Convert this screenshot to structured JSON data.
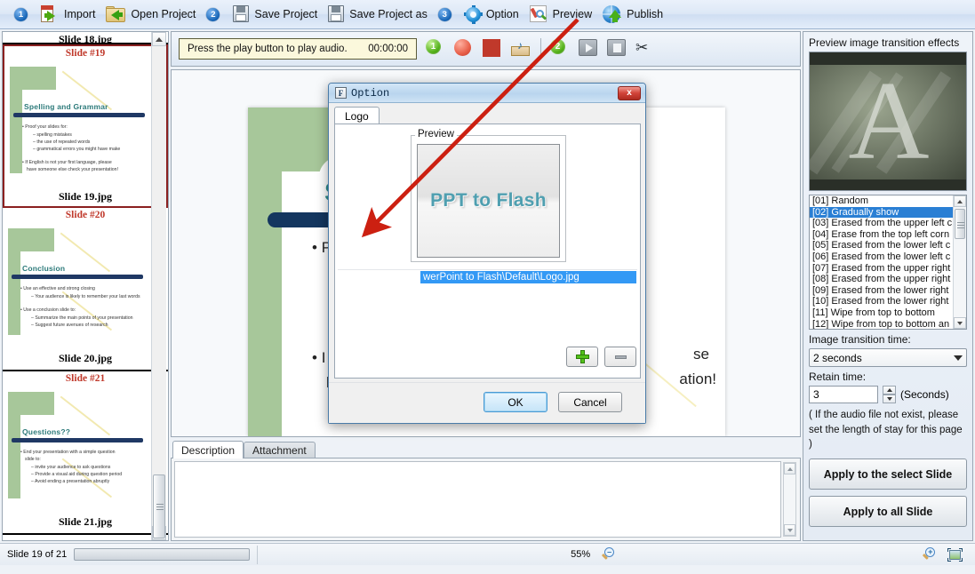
{
  "toolbar": {
    "steps": [
      {
        "badge": "1",
        "items": [
          {
            "label": "Import",
            "icon": "import-icon"
          },
          {
            "label": "Open Project",
            "icon": "open-folder-icon"
          }
        ]
      },
      {
        "badge": "2",
        "items": [
          {
            "label": "Save Project",
            "icon": "floppy-disk-icon"
          },
          {
            "label": "Save Project as",
            "icon": "floppy-disk-icon"
          }
        ]
      },
      {
        "badge": "3",
        "items": [
          {
            "label": "Option",
            "icon": "gear-icon"
          },
          {
            "label": "Preview",
            "icon": "magnifier-pencil-icon"
          },
          {
            "label": "Publish",
            "icon": "globe-upload-icon"
          }
        ]
      }
    ]
  },
  "slide_panel": {
    "thumbnails": [
      {
        "header": "",
        "footer": "Slide 18.jpg",
        "selected": false,
        "title": "",
        "bullets": []
      },
      {
        "header": "Slide #19",
        "footer": "Slide 19.jpg",
        "selected": true,
        "title": "Spelling and Grammar",
        "bullets": [
          "Proof your slides for:",
          "spelling mistakes",
          "the use of repeated words",
          "grammatical errors you might have make",
          "If English is not your first language, please",
          "have someone else check your presentation!"
        ]
      },
      {
        "header": "Slide #20",
        "footer": "Slide 20.jpg",
        "selected": false,
        "title": "Conclusion",
        "bullets": [
          "Use an effective and strong closing",
          "Your audience is likely to remember your last words",
          "Use a conclusion slide to:",
          "Summarize the main points of your presentation",
          "Suggest future avenues of research"
        ]
      },
      {
        "header": "Slide #21",
        "footer": "Slide 21.jpg",
        "selected": false,
        "title": "Questions??",
        "bullets": [
          "End your presentation with a simple question",
          "slide to:",
          "invite your audience to ask questions",
          "Provide a visual aid during question period",
          "Avoid ending a presentation abruptly"
        ]
      }
    ]
  },
  "audio_bar": {
    "message": "Press the play button to play audio.",
    "time": "00:00:00",
    "group1_badge": "1",
    "group2_badge": "2",
    "buttons": [
      {
        "name": "record-button",
        "icon": "record-circle-icon"
      },
      {
        "name": "stop-record-button",
        "icon": "stop-square-red-icon"
      },
      {
        "name": "import-audio-button",
        "icon": "audio-import-icon"
      },
      {
        "name": "play-button",
        "icon": "play-triangle-icon"
      },
      {
        "name": "stop-play-button",
        "icon": "stop-square-gray-icon"
      },
      {
        "name": "delete-audio-button",
        "icon": "scissors-icon"
      }
    ]
  },
  "slide_view": {
    "title": "Sp",
    "bullet1": "P",
    "bullet2_line1": "I",
    "bullet2_line2": "h",
    "right_text1": "se",
    "right_text2": "ation!"
  },
  "description": {
    "tabs": [
      {
        "label": "Description",
        "active": true
      },
      {
        "label": "Attachment",
        "active": false
      }
    ],
    "text": ""
  },
  "right_panel": {
    "preview_title": "Preview image transition effects",
    "preview_letter": "A",
    "effects": [
      {
        "index": "[01]",
        "label": "[01] Random",
        "selected": false
      },
      {
        "index": "[02]",
        "label": "[02] Gradually show",
        "selected": true
      },
      {
        "index": "[03]",
        "label": "[03] Erased from the upper left c",
        "selected": false
      },
      {
        "index": "[04]",
        "label": "[04] Erase from the top left corn",
        "selected": false
      },
      {
        "index": "[05]",
        "label": "[05] Erased from the lower left c",
        "selected": false
      },
      {
        "index": "[06]",
        "label": "[06] Erased from the lower left c",
        "selected": false
      },
      {
        "index": "[07]",
        "label": "[07] Erased from the upper right",
        "selected": false
      },
      {
        "index": "[08]",
        "label": "[08] Erased from the upper right",
        "selected": false
      },
      {
        "index": "[09]",
        "label": "[09] Erased from the lower right",
        "selected": false
      },
      {
        "index": "[10]",
        "label": "[10] Erased from the lower right",
        "selected": false
      },
      {
        "index": "[11]",
        "label": "[11] Wipe from top to bottom",
        "selected": false
      },
      {
        "index": "[12]",
        "label": "[12] Wipe from top to bottom an",
        "selected": false
      }
    ],
    "transition_time_label": "Image transition time:",
    "transition_time_value": "2 seconds",
    "retain_time_label": "Retain time:",
    "retain_time_value": "3",
    "seconds_label": "(Seconds)",
    "note_line1": "( If the audio file not exist, please",
    "note_line2": "set the length of stay for this page )",
    "apply_select_label": "Apply to the select Slide",
    "apply_all_label": "Apply to all Slide"
  },
  "dialog": {
    "title": "Option",
    "icon_letter": "F",
    "close_label": "x",
    "tab_label": "Logo",
    "preview_group_label": "Preview",
    "logo_text": "PPT to Flash",
    "file_item": "werPoint to Flash\\Default\\Logo.jpg",
    "add_label": "+",
    "remove_label": "−",
    "ok_label": "OK",
    "cancel_label": "Cancel"
  },
  "status_bar": {
    "slide_counter": "Slide 19 of 21",
    "zoom_level": "55%"
  },
  "colors": {
    "accent_blue": "#3399f5",
    "selection_blue": "#2a7fd4",
    "arrow_red": "#cc2011",
    "slide_red": "#c0392b",
    "slide_green": "#a7c79a",
    "title_teal": "#2f8f8f"
  }
}
